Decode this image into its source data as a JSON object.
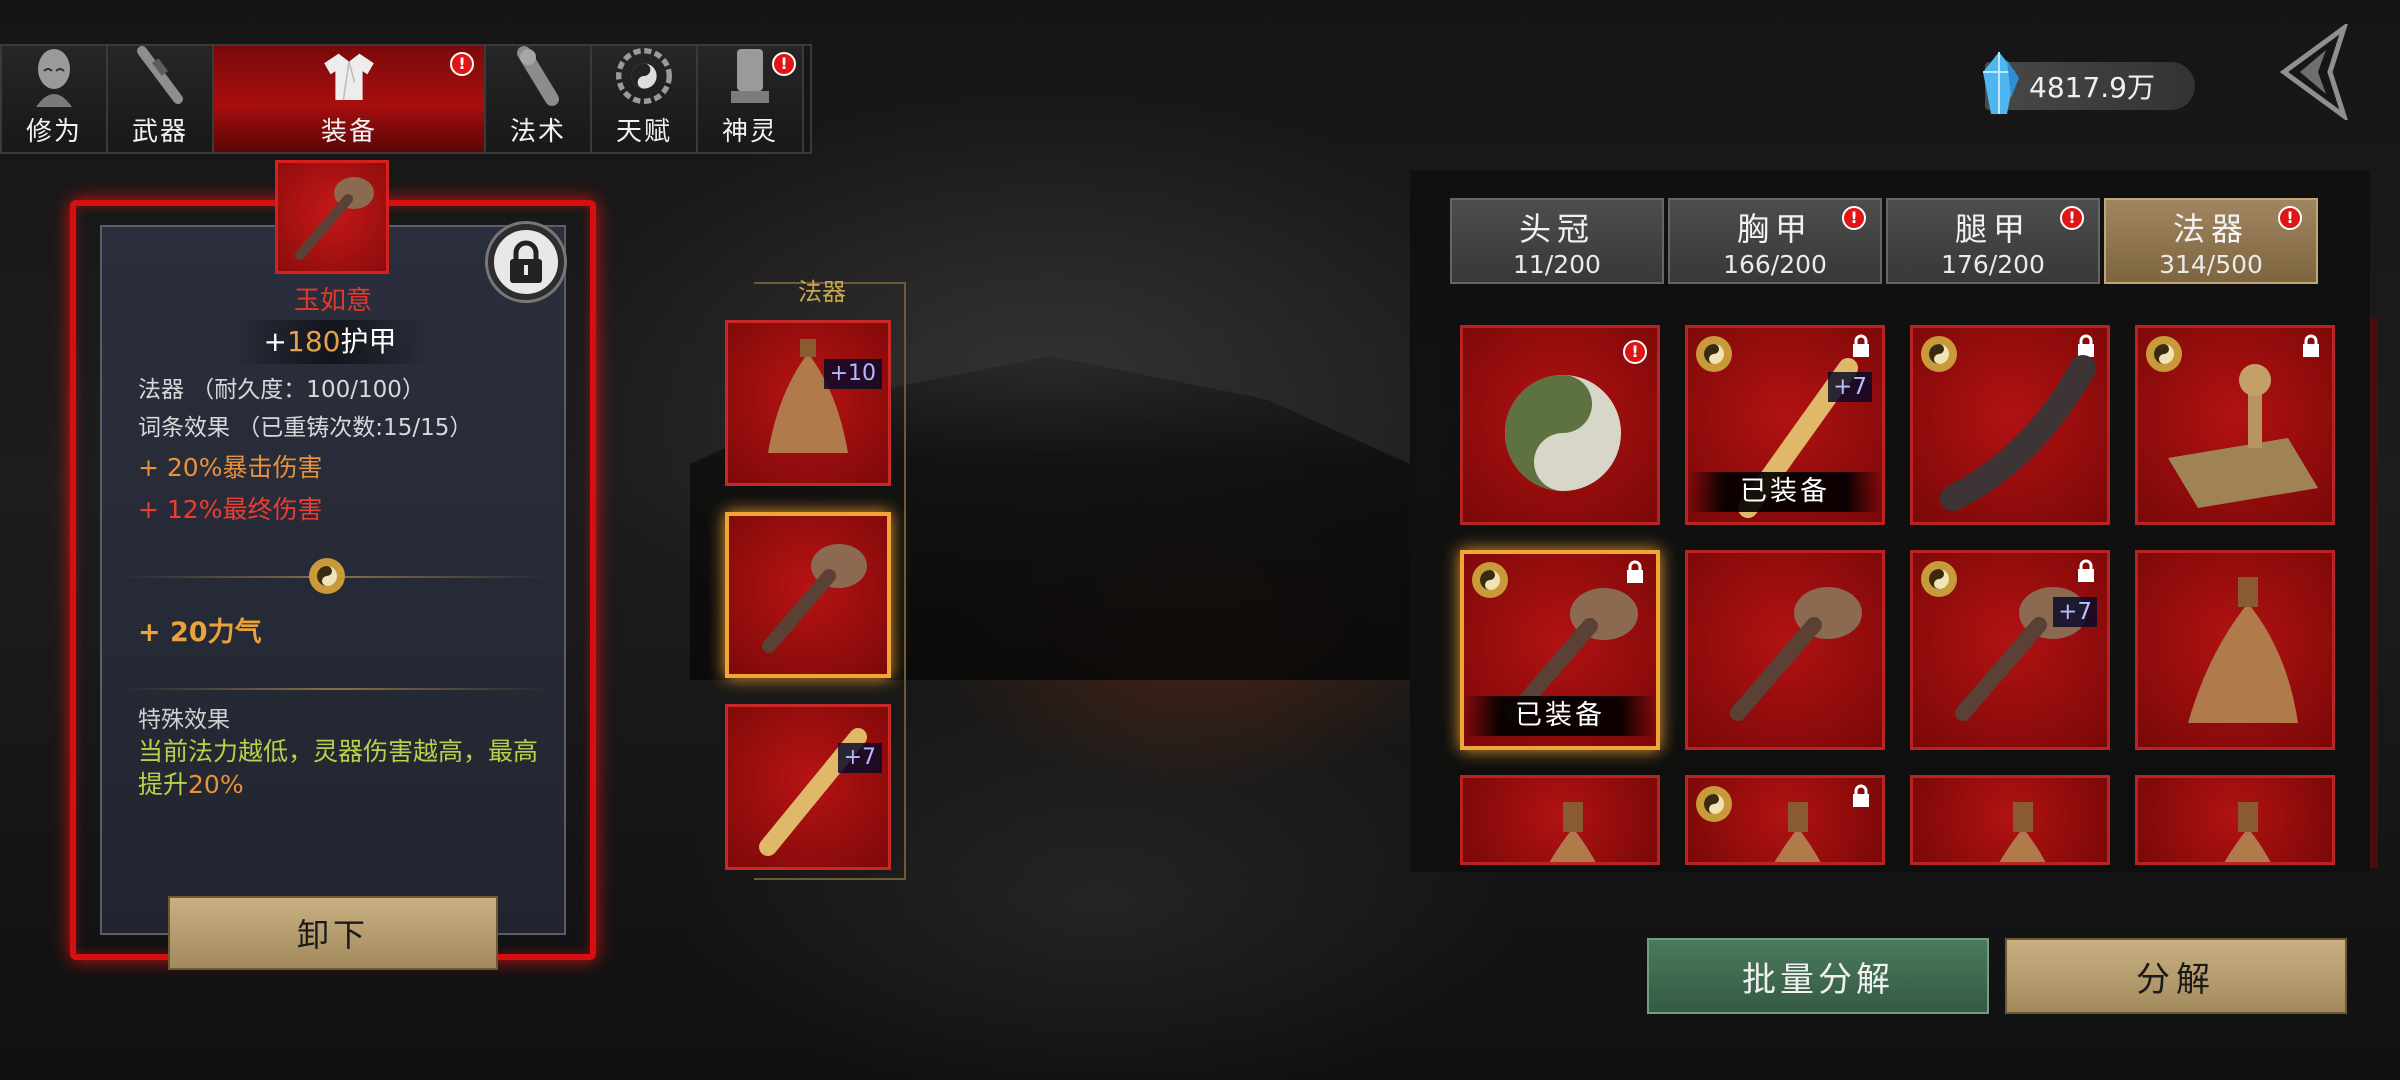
{
  "top_tabs": [
    {
      "label": "修为",
      "icon": "cultivation-head-icon",
      "active": false,
      "badge": false
    },
    {
      "label": "武器",
      "icon": "weapon-icon",
      "active": false,
      "badge": false
    },
    {
      "label": "装备",
      "icon": "robe-icon",
      "active": true,
      "badge": true
    },
    {
      "label": "法术",
      "icon": "gourd-icon",
      "active": false,
      "badge": false
    },
    {
      "label": "天赋",
      "icon": "bagua-icon",
      "active": false,
      "badge": false
    },
    {
      "label": "神灵",
      "icon": "spirit-tablet-icon",
      "active": false,
      "badge": true
    }
  ],
  "badge_symbol": "!",
  "currency": {
    "amount": "4817.9万",
    "icon": "spirit-crystal-icon"
  },
  "detail": {
    "item_name": "玉如意",
    "armor_plus": "+",
    "armor_value": "180",
    "armor_label": "护甲",
    "type_line": "法器 （耐久度：100/100）",
    "affix_line": "词条效果 （已重铸次数:15/15）",
    "affix_1": "+ 20%暴击伤害",
    "affix_2": "+ 12%最终伤害",
    "strength": "+ 20力气",
    "special_title": "特殊效果",
    "special_text_main": "当前法力越低，灵器伤害越高，最高提升",
    "special_text_pct": "20%",
    "unequip_label": "卸下"
  },
  "slot_column": {
    "label": "法器",
    "slots": [
      {
        "item": "bell",
        "enhance": "+10",
        "selected": false
      },
      {
        "item": "ruyi",
        "enhance": "",
        "selected": true
      },
      {
        "item": "wooden-sword",
        "enhance": "+7",
        "selected": false
      }
    ]
  },
  "categories": [
    {
      "name": "头冠",
      "count": "11/200",
      "active": false,
      "badge": false
    },
    {
      "name": "胸甲",
      "count": "166/200",
      "active": false,
      "badge": true
    },
    {
      "name": "腿甲",
      "count": "176/200",
      "active": false,
      "badge": true
    },
    {
      "name": "法器",
      "count": "314/500",
      "active": true,
      "badge": true
    }
  ],
  "inventory": [
    {
      "item": "taiji-stone",
      "coin": false,
      "lock": false,
      "enhance": "",
      "equipped": "",
      "badge": true,
      "selected": false
    },
    {
      "item": "wooden-sword",
      "coin": true,
      "lock": true,
      "enhance": "+7",
      "equipped": "已装备",
      "badge": false,
      "selected": false
    },
    {
      "item": "horn",
      "coin": true,
      "lock": true,
      "enhance": "",
      "equipped": "",
      "badge": false,
      "selected": false
    },
    {
      "item": "seal",
      "coin": true,
      "lock": true,
      "enhance": "",
      "equipped": "",
      "badge": false,
      "selected": false
    },
    {
      "item": "ruyi",
      "coin": true,
      "lock": true,
      "enhance": "",
      "equipped": "已装备",
      "badge": false,
      "selected": true
    },
    {
      "item": "ruyi",
      "coin": false,
      "lock": false,
      "enhance": "",
      "equipped": "",
      "badge": false,
      "selected": false
    },
    {
      "item": "ruyi",
      "coin": true,
      "lock": true,
      "enhance": "+7",
      "equipped": "",
      "badge": false,
      "selected": false
    },
    {
      "item": "bell",
      "coin": false,
      "lock": false,
      "enhance": "",
      "equipped": "",
      "badge": false,
      "selected": false
    },
    {
      "item": "bell",
      "coin": false,
      "lock": false,
      "enhance": "",
      "equipped": "",
      "badge": false,
      "selected": false
    },
    {
      "item": "bell",
      "coin": true,
      "lock": true,
      "enhance": "",
      "equipped": "",
      "badge": false,
      "selected": false
    },
    {
      "item": "bell",
      "coin": false,
      "lock": false,
      "enhance": "",
      "equipped": "",
      "badge": false,
      "selected": false
    },
    {
      "item": "bell",
      "coin": false,
      "lock": false,
      "enhance": "",
      "equipped": "",
      "badge": false,
      "selected": false
    }
  ],
  "buttons": {
    "batch_decompose": "批量分解",
    "decompose": "分解"
  },
  "colors": {
    "accent_red": "#c21212",
    "gold": "#c8a64e",
    "selection_orange": "#f0a636",
    "affix_orange": "#e8913a",
    "affix_red": "#ef3b30",
    "special_green": "#b6d24a"
  }
}
